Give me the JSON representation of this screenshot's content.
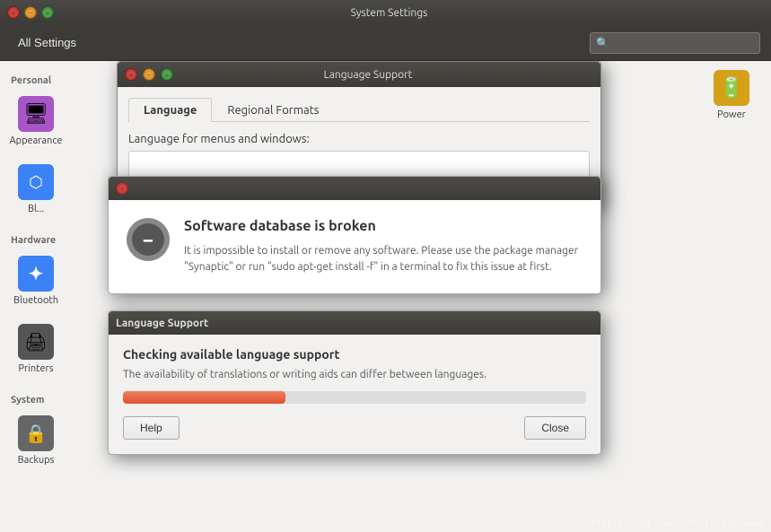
{
  "window": {
    "title": "System Settings",
    "controls": {
      "close": "×",
      "minimize": "−",
      "maximize": "+"
    }
  },
  "topbar": {
    "all_settings": "All Settings",
    "search_placeholder": ""
  },
  "personal": {
    "label": "Personal",
    "items": [
      {
        "id": "appearance",
        "label": "Appearance",
        "icon": "🖥",
        "color": "#9b59b6"
      },
      {
        "id": "bluetooth-truncated",
        "label": "Bl...",
        "icon": "✦",
        "color": "#3b82f6"
      }
    ]
  },
  "hardware": {
    "label": "Hardware",
    "items": [
      {
        "id": "bluetooth",
        "label": "Bluetooth",
        "icon": "✦",
        "color": "#3b82f6"
      },
      {
        "id": "printers",
        "label": "Printers",
        "icon": "🖨",
        "color": "#555"
      },
      {
        "id": "power",
        "label": "Power",
        "icon": "🔋",
        "color": "#eab308"
      }
    ]
  },
  "system_section": {
    "label": "System",
    "items": [
      {
        "id": "backups",
        "label": "Backups",
        "icon": "🔒",
        "color": "#666"
      }
    ]
  },
  "language_dialog": {
    "title": "Language Support",
    "tabs": [
      {
        "id": "language",
        "label": "Language",
        "active": true
      },
      {
        "id": "regional",
        "label": "Regional Formats",
        "active": false
      }
    ],
    "lang_section_label": "Language for menus and windows:"
  },
  "broken_dialog": {
    "title": "",
    "heading": "Software database is broken",
    "body": "It is impossible to install or remove any software. Please use the package manager \"Synaptic\" or run \"sudo apt-get install -f\" in a terminal to fix this issue at first."
  },
  "progress_dialog": {
    "titlebar": "Language Support",
    "heading": "Checking available language support",
    "subtitle": "The availability of translations or writing aids can differ between languages.",
    "progress_percent": 35,
    "btn_help": "Help",
    "btn_close": "Close"
  },
  "watermark": "http://blog.csdn.net/leijieZhang"
}
